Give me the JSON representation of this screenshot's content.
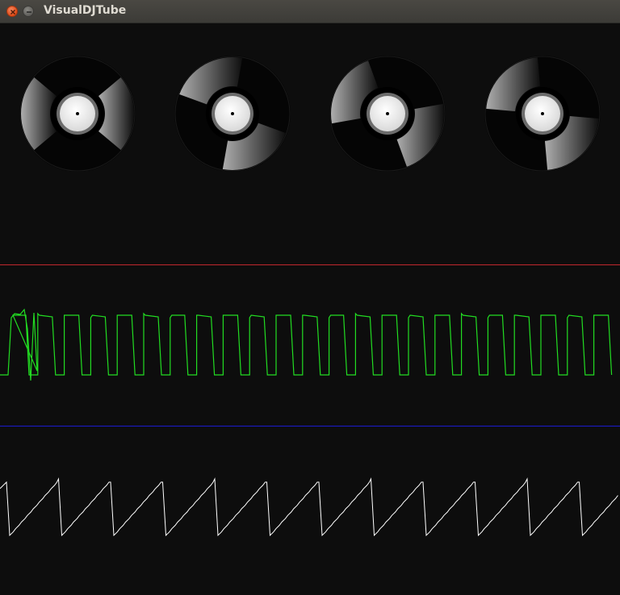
{
  "window": {
    "title": "VisualDJTube"
  },
  "colors": {
    "background": "#0d0d0d",
    "divider_top": "#c1272d",
    "divider_bottom": "#1b1bd0",
    "waveform_top": "#22dd22",
    "waveform_bottom": "#ffffff"
  },
  "turntables": [
    {
      "name": "deck-1",
      "rotation_deg": 0
    },
    {
      "name": "deck-2",
      "rotation_deg": 60
    },
    {
      "name": "deck-3",
      "rotation_deg": 30
    },
    {
      "name": "deck-4",
      "rotation_deg": 45
    }
  ]
}
